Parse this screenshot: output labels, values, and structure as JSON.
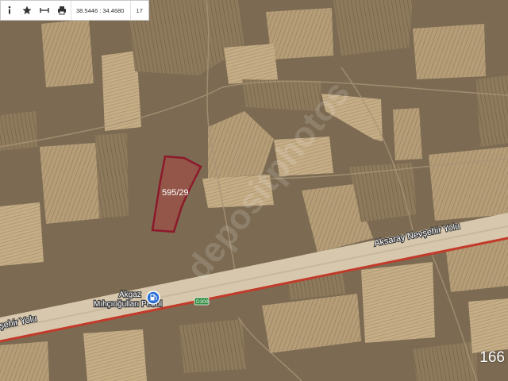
{
  "toolbar": {
    "info_icon": "info-icon",
    "favorite_icon": "star-icon",
    "measure_icon": "ruler-icon",
    "print_icon": "printer-icon",
    "coordinates": "38.5446 : 34.4680",
    "zoom_level": "17"
  },
  "parcel": {
    "label": "595/29",
    "outline_color": "#8b1a2b",
    "fill_color": "#c0303a"
  },
  "road": {
    "name_east": "Aksaray Nevşehir Yolu",
    "name_west": "şehir Yolu",
    "shield": "D300",
    "edge_color": "#c23a2a"
  },
  "poi": {
    "line1": "Akgaz",
    "line2": "Mıhçıoğulları Petrol",
    "icon": "fuel-station-icon"
  },
  "watermark": "depositphotos",
  "corner_number": "166"
}
